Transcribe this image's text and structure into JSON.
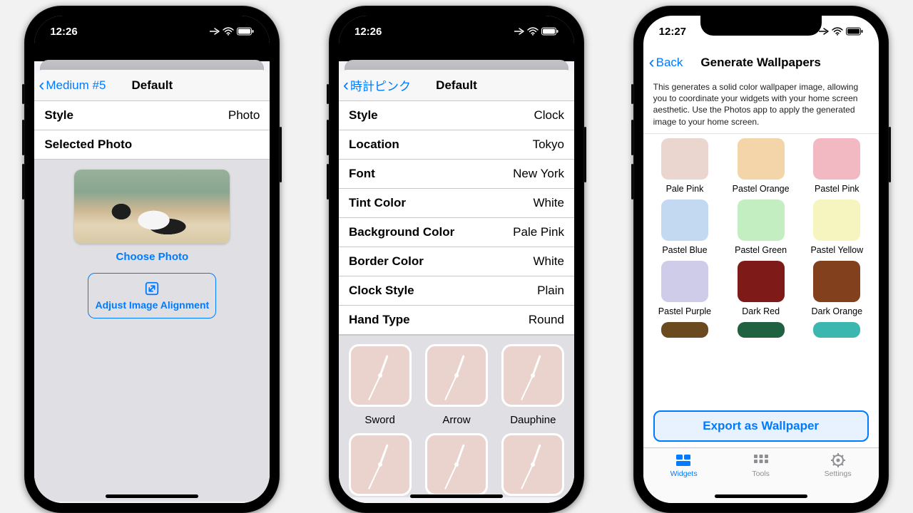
{
  "phone1": {
    "time": "12:26",
    "back": "Medium #5",
    "title": "Default",
    "rows": {
      "style_label": "Style",
      "style_val": "Photo"
    },
    "selected_photo": "Selected Photo",
    "choose": "Choose Photo",
    "align": "Adjust Image Alignment"
  },
  "phone2": {
    "time": "12:26",
    "back": "時計ピンク",
    "title": "Default",
    "rows": [
      {
        "label": "Style",
        "val": "Clock"
      },
      {
        "label": "Location",
        "val": "Tokyo"
      },
      {
        "label": "Font",
        "val": "New York"
      },
      {
        "label": "Tint Color",
        "val": "White"
      },
      {
        "label": "Background Color",
        "val": "Pale Pink"
      },
      {
        "label": "Border Color",
        "val": "White"
      },
      {
        "label": "Clock Style",
        "val": "Plain"
      },
      {
        "label": "Hand Type",
        "val": "Round"
      }
    ],
    "hands": [
      "Sword",
      "Arrow",
      "Dauphine"
    ]
  },
  "phone3": {
    "time": "12:27",
    "back": "Back",
    "title": "Generate Wallpapers",
    "desc": "This generates a solid color wallpaper image, allowing you to coordinate your widgets with your home screen aesthetic.  Use the Photos app to apply the generated image to your home screen.",
    "colors": [
      {
        "name": "Pale Pink",
        "hex": "#ead5cf"
      },
      {
        "name": "Pastel Orange",
        "hex": "#f4d5aa"
      },
      {
        "name": "Pastel Pink",
        "hex": "#f3b9c2"
      },
      {
        "name": "Pastel Blue",
        "hex": "#c3d9f2"
      },
      {
        "name": "Pastel Green",
        "hex": "#c2eec2"
      },
      {
        "name": "Pastel Yellow",
        "hex": "#f6f5bf"
      },
      {
        "name": "Pastel Purple",
        "hex": "#cfccea"
      },
      {
        "name": "Dark Red",
        "hex": "#7e1b18"
      },
      {
        "name": "Dark Orange",
        "hex": "#83401d"
      }
    ],
    "colors_cut": [
      {
        "hex": "#6c4a1f"
      },
      {
        "hex": "#1f6140"
      },
      {
        "hex": "#3cb7af"
      }
    ],
    "export": "Export as Wallpaper",
    "tabs": {
      "widgets": "Widgets",
      "tools": "Tools",
      "settings": "Settings"
    }
  }
}
